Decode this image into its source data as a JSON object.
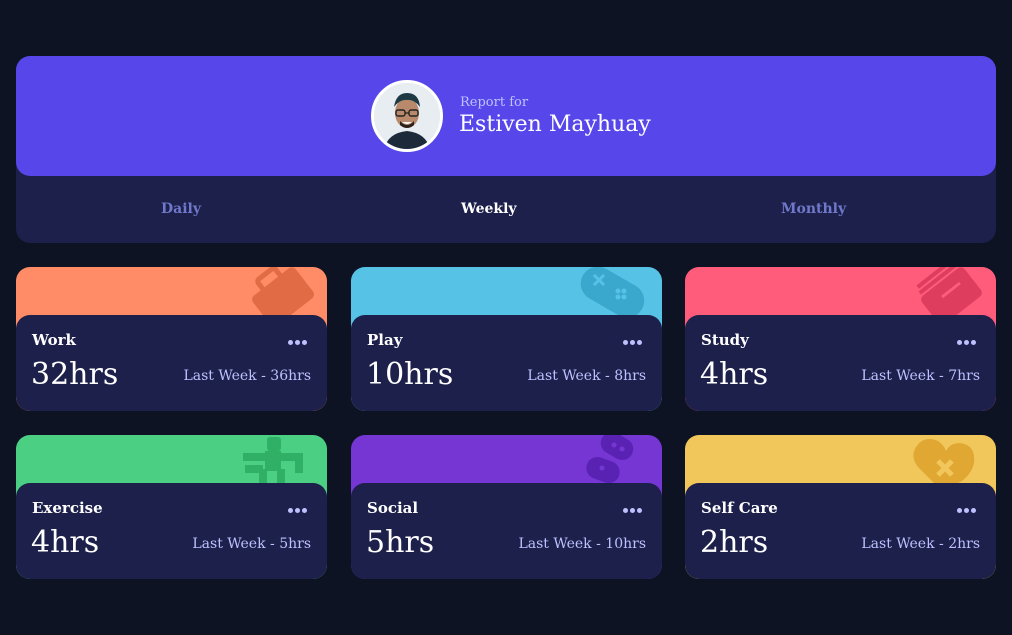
{
  "profile": {
    "report_label": "Report for",
    "name": "Estiven Mayhuay"
  },
  "tabs": [
    {
      "label": "Daily",
      "active": false
    },
    {
      "label": "Weekly",
      "active": true
    },
    {
      "label": "Monthly",
      "active": false
    }
  ],
  "cards": [
    {
      "title": "Work",
      "current": "32hrs",
      "previous": "Last Week - 36hrs",
      "color": "#ff8c66",
      "icon": "briefcase-icon"
    },
    {
      "title": "Play",
      "current": "10hrs",
      "previous": "Last Week - 8hrs",
      "color": "#56c2e6",
      "icon": "gamepad-icon"
    },
    {
      "title": "Study",
      "current": "4hrs",
      "previous": "Last Week - 7hrs",
      "color": "#ff5c7c",
      "icon": "books-icon"
    },
    {
      "title": "Exercise",
      "current": "4hrs",
      "previous": "Last Week - 5hrs",
      "color": "#4bcf83",
      "icon": "running-icon"
    },
    {
      "title": "Social",
      "current": "5hrs",
      "previous": "Last Week - 10hrs",
      "color": "#7536d3",
      "icon": "social-icon"
    },
    {
      "title": "Self Care",
      "current": "2hrs",
      "previous": "Last Week - 2hrs",
      "color": "#f1c65b",
      "icon": "heart-icon"
    }
  ],
  "colors": {
    "page_bg": "#0e1323",
    "panel": "#1c204b",
    "accent": "#5747ea",
    "pale_blue": "#bdc1ff",
    "desaturated_blue": "#7078c9"
  }
}
